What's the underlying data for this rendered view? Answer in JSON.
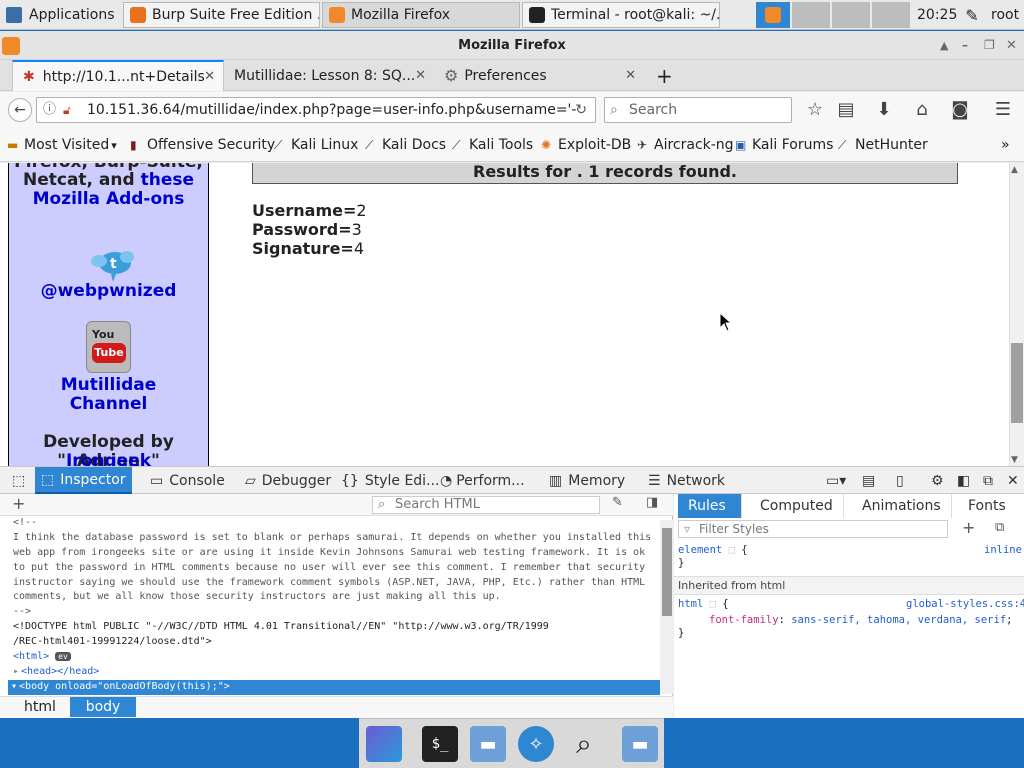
{
  "panel": {
    "applications": "Applications",
    "tasks": [
      {
        "label": "Burp Suite Free Edition ..."
      },
      {
        "label": "Mozilla Firefox"
      },
      {
        "label": "Terminal - root@kali: ~/..."
      }
    ],
    "time": "20:25",
    "user": "root"
  },
  "firefox": {
    "window_title": "Mozilla Firefox",
    "tabs": [
      {
        "label": "http://10.1...nt+Details"
      },
      {
        "label": "Mutillidae: Lesson 8: SQ..."
      },
      {
        "label": "Preferences"
      }
    ],
    "url": "10.151.36.64/mutillidae/index.php?page=user-info.php&username='-",
    "search_placeholder": "Search",
    "bookmarks": [
      "Most Visited",
      "Offensive Security",
      "Kali Linux",
      "Kali Docs",
      "Kali Tools",
      "Exploit-DB",
      "Aircrack-ng",
      "Kali Forums",
      "NetHunter"
    ]
  },
  "page": {
    "sidebar": {
      "line1": "Firefox, Burp-Suite,",
      "line2a": "Netcat, and",
      "line2b": "these",
      "line3": "Mozilla Add-ons",
      "twitter": "@webpwnized",
      "youtube_line1": "Mutillidae",
      "youtube_line2": "Channel",
      "dev_line1": "Developed by Adrian",
      "dev_quote_open": "\"",
      "dev_name": "Irongeek",
      "dev_quote_close": "\" Crenshaw"
    },
    "results_header": "Results for . 1 records found.",
    "records": [
      {
        "label": "Username=",
        "value": "2"
      },
      {
        "label": "Password=",
        "value": "3"
      },
      {
        "label": "Signature=",
        "value": "4"
      }
    ]
  },
  "devtools": {
    "tabs": [
      "Inspector",
      "Console",
      "Debugger",
      "Style Edi...",
      "Perform...",
      "Memory",
      "Network"
    ],
    "search_html_placeholder": "Search HTML",
    "code_lines": [
      "<!--",
      "I think the database password is set to blank or perhaps samurai. It depends on whether you installed this",
      "web app from irongeeks site or are using it inside Kevin Johnsons Samurai web testing framework. It is ok",
      "to put the password in HTML comments because no user will ever see this comment. I remember that security",
      "instructor saying we should use the framework comment symbols (ASP.NET, JAVA, PHP, Etc.) rather than HTML",
      "comments, but we all know those security instructors are just making all this up.",
      "-->",
      "<!DOCTYPE html PUBLIC \"-//W3C//DTD HTML 4.01 Transitional//EN\" \"http://www.w3.org/TR/1999",
      "/REC-html401-19991224/loose.dtd\">",
      "<html>",
      "<head></head>",
      "<body onload=\"onLoadOfBody(this);\">"
    ],
    "ev_badge": "ev",
    "breadcrumbs": [
      "html",
      "body"
    ],
    "rules_tabs": [
      "Rules",
      "Computed",
      "Animations",
      "Fonts"
    ],
    "filter_placeholder": "Filter Styles",
    "rules": {
      "element_selector": "element",
      "element_open": "{",
      "element_source": "inline",
      "element_close": "}",
      "inherited_label": "Inherited from html",
      "html_selector": "html",
      "html_open": "{",
      "html_source": "global-styles.css:4",
      "property": "font-family",
      "value": "sans-serif, tahoma, verdana, serif",
      "html_close": "}"
    }
  },
  "colors": {
    "accent": "#2f86d3",
    "sidebar_bg": "#ccccff",
    "link": "#0000cc",
    "desktop": "#1a6fbf"
  }
}
